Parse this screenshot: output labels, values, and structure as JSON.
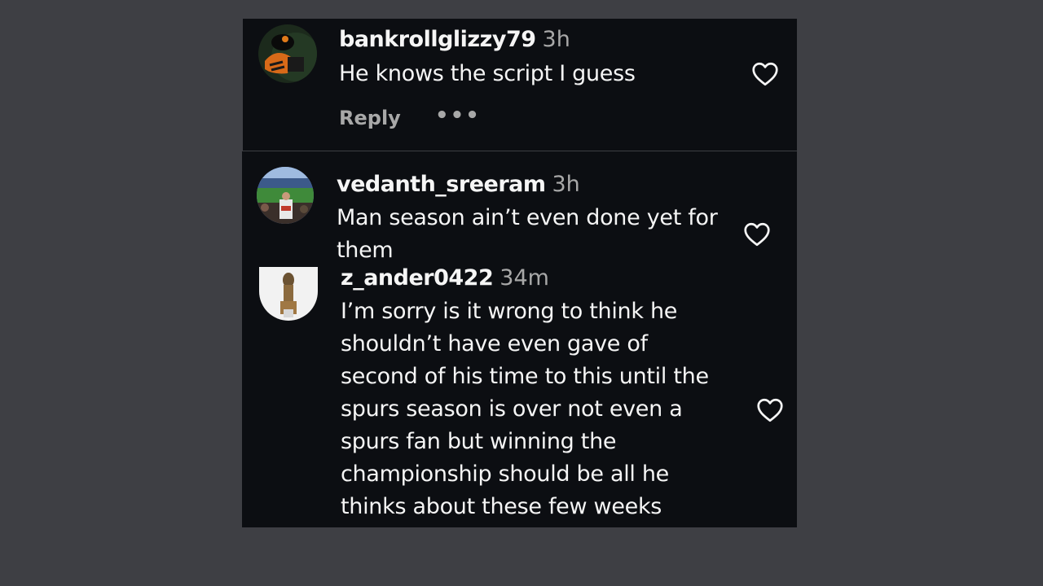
{
  "comments": [
    {
      "username": "bankrollglizzy79",
      "time": "3h",
      "text": "He knows the script I guess",
      "reply_label": "Reply",
      "more_label": "•••",
      "avatar_icon": "avatar-photo-dark-orange",
      "heart_icon": "heart-outline-icon"
    },
    {
      "username": "vedanth_sreeram",
      "time": "3h",
      "text_lines": [
        "Man season ain’t even done yet for",
        "them"
      ],
      "avatar_icon": "avatar-photo-stadium",
      "heart_icon": "heart-outline-icon"
    },
    {
      "username": "z_ander0422",
      "time": "34m",
      "text_lines": [
        "I’m sorry is it wrong to think he",
        "shouldn’t have even gave of",
        "second of his time to this until the",
        "spurs season is over not even a",
        "spurs fan but winning the",
        "championship should be all he",
        "thinks about these few weeks"
      ],
      "avatar_icon": "avatar-photo-statue",
      "heart_icon": "heart-outline-icon"
    }
  ],
  "colors": {
    "background": "#3e3f44",
    "panel": "#0c0e12",
    "text": "#f5f5f5",
    "muted": "#a8a8a8"
  }
}
